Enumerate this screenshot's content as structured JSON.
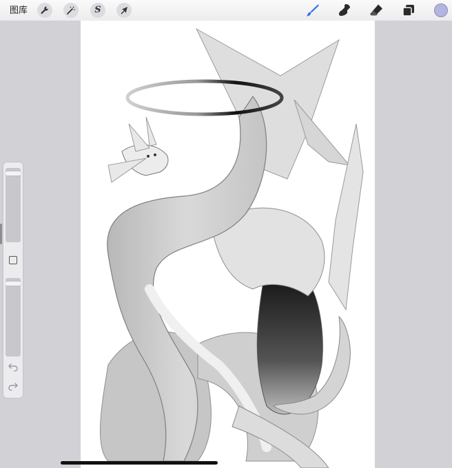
{
  "topbar": {
    "gallery_label": "图库",
    "left_tools": [
      {
        "name": "actions",
        "icon": "wrench-icon"
      },
      {
        "name": "adjustments",
        "icon": "magic-wand-icon"
      },
      {
        "name": "selection",
        "icon": "selection-s-icon"
      },
      {
        "name": "transform",
        "icon": "arrow-cursor-icon"
      }
    ],
    "right_tools": [
      {
        "name": "brush",
        "icon": "brush-icon",
        "active": true
      },
      {
        "name": "smudge",
        "icon": "smudge-icon"
      },
      {
        "name": "eraser",
        "icon": "eraser-icon"
      },
      {
        "name": "layers",
        "icon": "layers-icon"
      }
    ],
    "selection_glyph": "S",
    "active_color": "#b3b4e0",
    "accent_color": "#2f6fe4"
  },
  "sidebar": {
    "brush_size_level": 0.05,
    "opacity_level": 0.05,
    "modify_icon": "square-icon",
    "undo_icon": "undo-icon",
    "redo_icon": "redo-icon"
  }
}
